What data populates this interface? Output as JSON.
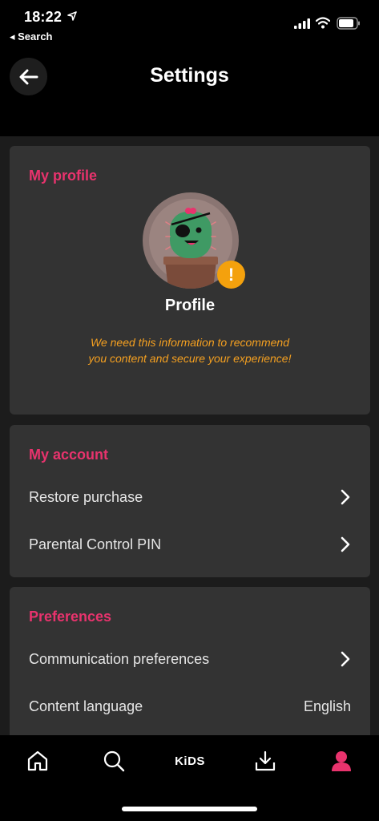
{
  "status_bar": {
    "time": "18:22",
    "back_app": "◂ Search"
  },
  "header": {
    "title": "Settings"
  },
  "profile_card": {
    "title": "My profile",
    "profile_name": "Profile",
    "note": "We need this information to recommend you content and secure your experience!",
    "warning_glyph": "!"
  },
  "account_card": {
    "title": "My account",
    "items": [
      {
        "label": "Restore purchase"
      },
      {
        "label": "Parental Control PIN"
      }
    ]
  },
  "preferences_card": {
    "title": "Preferences",
    "items": [
      {
        "label": "Communication preferences"
      },
      {
        "label": "Content language",
        "value": "English"
      }
    ]
  },
  "bottom_nav": {
    "items": [
      {
        "icon": "home-icon"
      },
      {
        "icon": "search-icon"
      },
      {
        "label": "KiDS"
      },
      {
        "icon": "download-icon"
      },
      {
        "icon": "profile-icon",
        "active": true
      }
    ]
  },
  "colors": {
    "accent": "#e8336d",
    "warning": "#f4a10d",
    "note": "#f5a020",
    "card": "#333333"
  }
}
